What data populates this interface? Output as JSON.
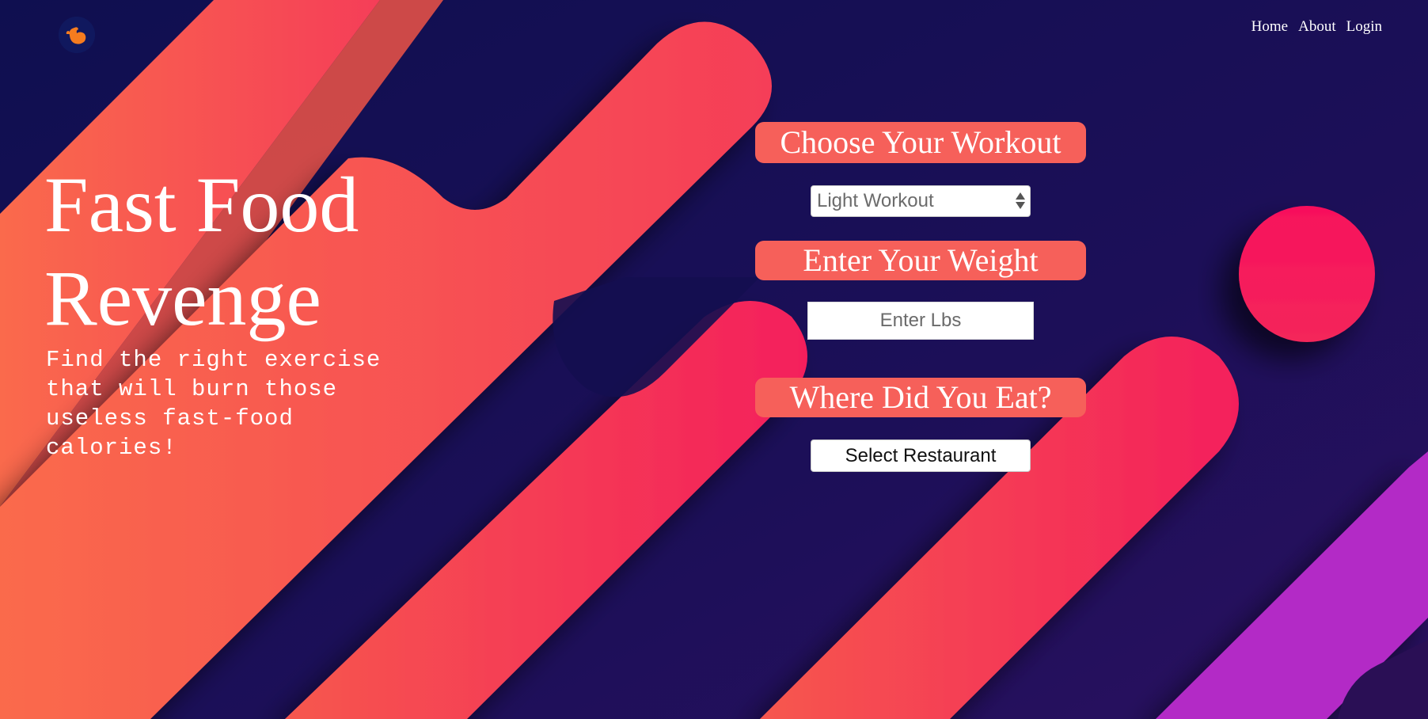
{
  "logo": {
    "icon": "flexed-bicep-icon"
  },
  "nav": {
    "home": "Home",
    "about": "About",
    "login": "Login"
  },
  "hero": {
    "title": "Fast Food Revenge",
    "subtitle": "Find the right exercise that will burn those useless fast-food calories!"
  },
  "form": {
    "workout_heading": "Choose Your Workout",
    "workout_selected": "Light Workout",
    "weight_heading": "Enter Your Weight",
    "weight_placeholder": "Enter Lbs",
    "weight_value": "",
    "restaurant_heading": "Where Did You Eat?",
    "restaurant_button": "Select Restaurant"
  },
  "colors": {
    "background": "#1a0f52",
    "coral": "#f6605a",
    "pink": "#f5235a",
    "purple": "#b32ac6",
    "logo_orange": "#f57c1f"
  }
}
